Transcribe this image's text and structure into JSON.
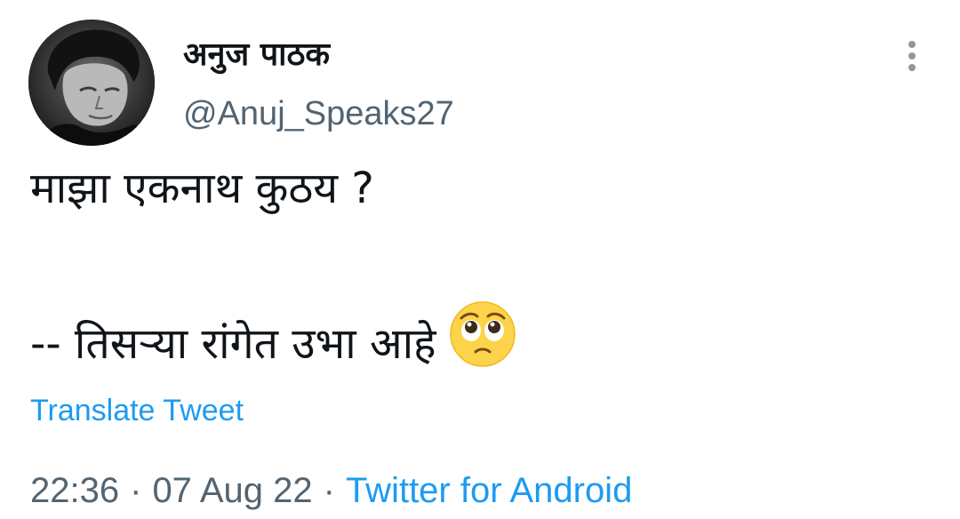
{
  "tweet": {
    "author": {
      "display_name": "अनुज पाठक",
      "handle": "@Anuj_Speaks27",
      "avatar_icon": "profile-photo"
    },
    "more_icon": "more-options-icon",
    "text_line1": "माझा एकनाथ कुठय ?",
    "text_line3": "-- तिसऱ्या रांगेत उभा आहे",
    "emoji_icon": "pleading-face-emoji-icon",
    "translate_label": "Translate Tweet",
    "time": "22:36",
    "date": "07 Aug 22",
    "separator": "·",
    "source": "Twitter for Android",
    "colors": {
      "link": "#1d9bf0",
      "muted": "#536471",
      "text": "#0f1419"
    }
  }
}
